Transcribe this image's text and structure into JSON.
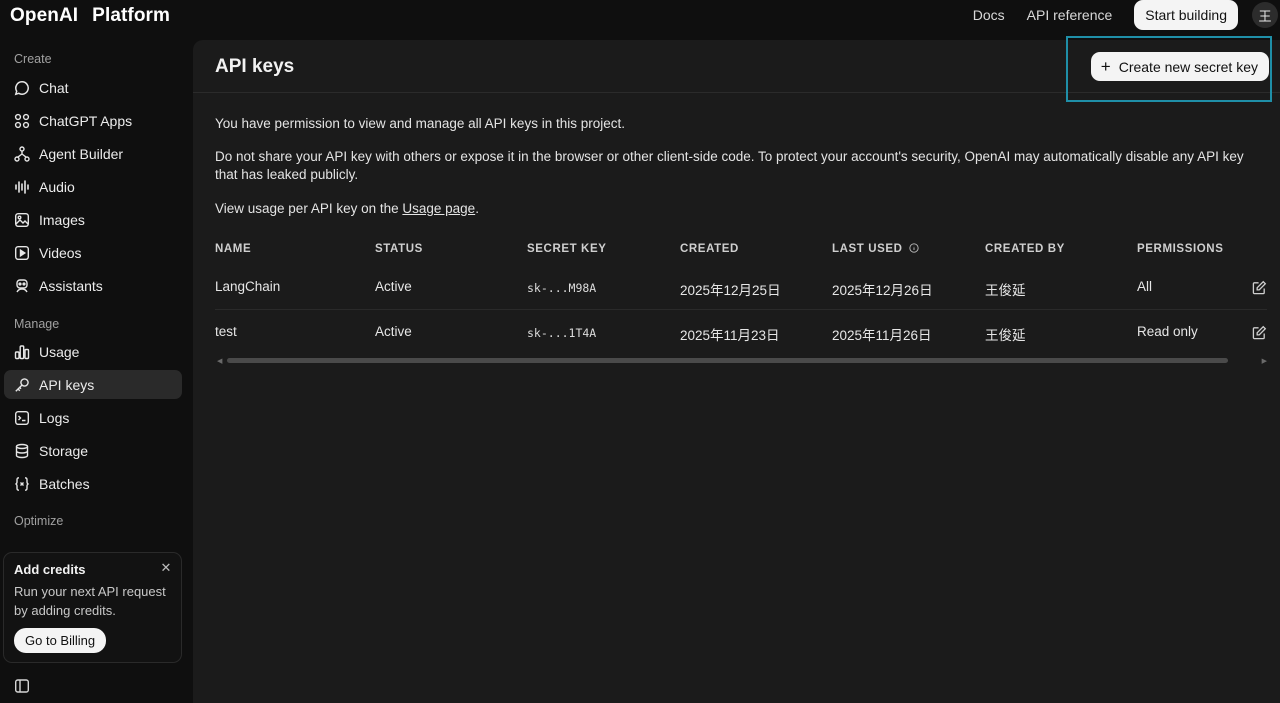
{
  "brand": {
    "name": "OpenAI",
    "product": "Platform"
  },
  "top_nav": {
    "docs": "Docs",
    "api_reference": "API reference",
    "start_building": "Start building",
    "avatar_initial": "王"
  },
  "sidebar": {
    "sections": {
      "create": "Create",
      "manage": "Manage",
      "optimize": "Optimize"
    },
    "create_items": [
      {
        "label": "Chat",
        "icon": "chat-bubble-icon"
      },
      {
        "label": "ChatGPT Apps",
        "icon": "apps-grid-icon"
      },
      {
        "label": "Agent Builder",
        "icon": "agent-flow-icon"
      },
      {
        "label": "Audio",
        "icon": "audio-wave-icon"
      },
      {
        "label": "Images",
        "icon": "image-icon"
      },
      {
        "label": "Videos",
        "icon": "video-play-icon"
      },
      {
        "label": "Assistants",
        "icon": "assistant-robot-icon"
      }
    ],
    "manage_items": [
      {
        "label": "Usage",
        "icon": "bar-chart-icon"
      },
      {
        "label": "API keys",
        "icon": "key-icon",
        "active": true
      },
      {
        "label": "Logs",
        "icon": "terminal-icon"
      },
      {
        "label": "Storage",
        "icon": "database-icon"
      },
      {
        "label": "Batches",
        "icon": "braces-icon"
      }
    ],
    "credits": {
      "title": "Add credits",
      "text": "Run your next API request by adding credits.",
      "button": "Go to Billing"
    }
  },
  "main": {
    "title": "API keys",
    "create_button": "Create new secret key",
    "para1": "You have permission to view and manage all API keys in this project.",
    "para2": "Do not share your API key with others or expose it in the browser or other client-side code. To protect your account's security, OpenAI may automatically disable any API key that has leaked publicly.",
    "para3_prefix": "View usage per API key on the ",
    "para3_link": "Usage page",
    "para3_suffix": "."
  },
  "table": {
    "headers": {
      "name": "NAME",
      "status": "STATUS",
      "secret_key": "SECRET KEY",
      "created": "CREATED",
      "last_used": "LAST USED",
      "created_by": "CREATED BY",
      "permissions": "PERMISSIONS"
    },
    "rows": [
      {
        "name": "LangChain",
        "status": "Active",
        "secret_key": "sk-...M98A",
        "created": "2025年12月25日",
        "last_used": "2025年12月26日",
        "created_by": "王俊延",
        "permissions": "All"
      },
      {
        "name": "test",
        "status": "Active",
        "secret_key": "sk-...1T4A",
        "created": "2025年11月23日",
        "last_used": "2025年11月26日",
        "created_by": "王俊延",
        "permissions": "Read only"
      }
    ]
  },
  "colors": {
    "page_bg": "#0f0f0f",
    "panel_bg": "#1b1b1b",
    "highlight": "#1f8fa8",
    "button_bg": "#f4f4f4"
  }
}
